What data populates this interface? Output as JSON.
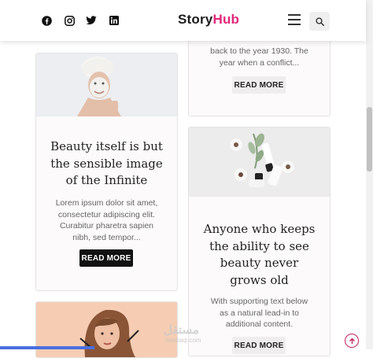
{
  "header": {
    "brand_main": "Story",
    "brand_accent": "Hub",
    "social_icons": [
      "facebook-icon",
      "instagram-icon",
      "twitter-icon",
      "linkedin-icon"
    ]
  },
  "cards": {
    "card1": {
      "title_lines": [
        "Beauty itself is but",
        "the sensible image",
        "of the Infinite"
      ],
      "text_lines": [
        "Lorem ipsum dolor sit amet,",
        "consectetur adipiscing elit.",
        "Curabitur pharetra sapien",
        "nibh, sed tempor..."
      ],
      "button": "READ MORE"
    },
    "card_top_right": {
      "text_lines": [
        "back to the year 1930. The",
        "year when a conflict..."
      ],
      "button": "READ MORE"
    },
    "card2": {
      "title_lines": [
        "Anyone who keeps",
        "the ability to see",
        "beauty never",
        "grows old"
      ],
      "text_lines": [
        "With supporting text below",
        "as a natural lead-in to",
        "additional content."
      ],
      "button": "READ MORE"
    }
  },
  "watermark": {
    "arabic": "مستقل",
    "latin": "mostaql.com"
  },
  "colors": {
    "brand_accent": "#e2277a",
    "dark_button": "#111111",
    "light_button": "#efedee"
  }
}
